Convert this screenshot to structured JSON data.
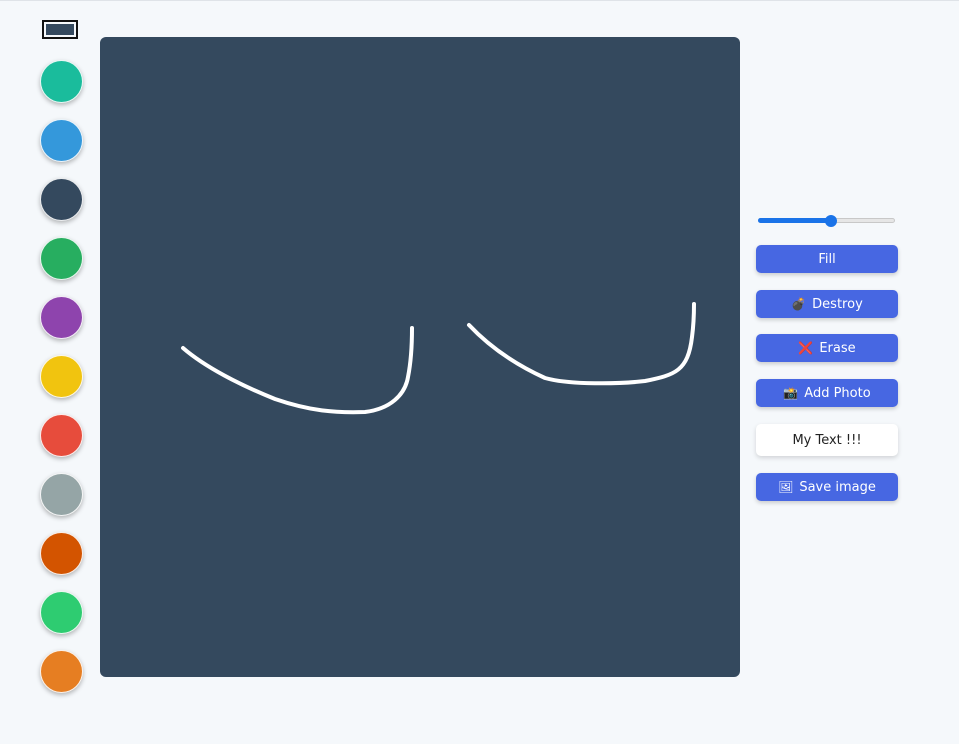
{
  "palette": {
    "selected_color": "#34495e",
    "colors": [
      "#1abc9c",
      "#3498db",
      "#34495e",
      "#27ae60",
      "#8e44ad",
      "#f1c40f",
      "#e74c3c",
      "#95a5a6",
      "#d35400",
      "#2ecc71",
      "#e67e22"
    ]
  },
  "canvas": {
    "background": "#34495e",
    "stroke_color": "#ffffff"
  },
  "controls": {
    "brush_size_fraction": 0.53,
    "fill_label": "Fill",
    "destroy_icon": "bomb-icon",
    "destroy_glyph": "💣",
    "destroy_label": "Destroy",
    "erase_icon": "cross-mark-icon",
    "erase_glyph": "❌",
    "erase_label": "Erase",
    "add_photo_icon": "camera-flash-icon",
    "add_photo_glyph": "📸",
    "add_photo_label": "Add Photo",
    "text_value": "My Text !!!",
    "save_icon": "framed-picture-icon",
    "save_glyph": "🖼",
    "save_label": "Save image"
  }
}
